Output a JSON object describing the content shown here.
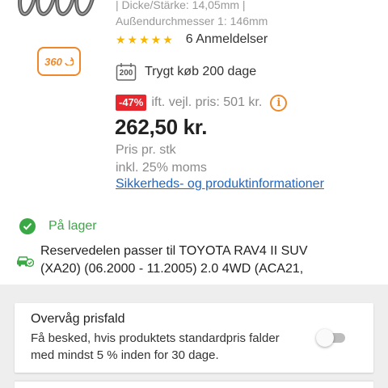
{
  "product": {
    "spec_line_1": "| Dicke/Stärke: 14,05mm |",
    "spec_line_2": "Außendurchmesser 1: 146mm",
    "rating_stars": "★★★★★",
    "reviews": "6 Anmeldelser",
    "view360_label": "360",
    "trygt_icon_label": "200",
    "trygt_text": "Trygt køb 200 dage",
    "discount": "-47%",
    "rrp_text": "ift. vejl. pris: 501 kr.",
    "info_icon_glyph": "i",
    "price": "262,50 kr.",
    "price_per": "Pris pr. stk",
    "vat_note": "inkl. 25% moms",
    "safety_link": "Sikkerheds- og produktinformationer"
  },
  "stock": {
    "label": "På lager"
  },
  "fitment": {
    "text": "Reservedelen passer til TOYOTA RAV4 II SUV\n(XA20) (06.2000 - 11.2005) 2.0 4WD (ACA21,"
  },
  "price_watch": {
    "title": "Overvåg prisfald",
    "description": "Få besked, hvis produktets standardpris falder med mindst 5 % inden for 30 dage.",
    "toggle_on": false
  },
  "colors": {
    "accent_orange": "#f0882a",
    "discount_red": "#e8262e",
    "link_blue": "#2166c2",
    "stock_green": "#3aa845",
    "star_yellow": "#f7b500"
  },
  "icons": {
    "view360": "rotate-360-icon",
    "calendar": "calendar-icon",
    "info": "info-icon",
    "check": "check-circle-icon",
    "car": "car-check-icon"
  }
}
